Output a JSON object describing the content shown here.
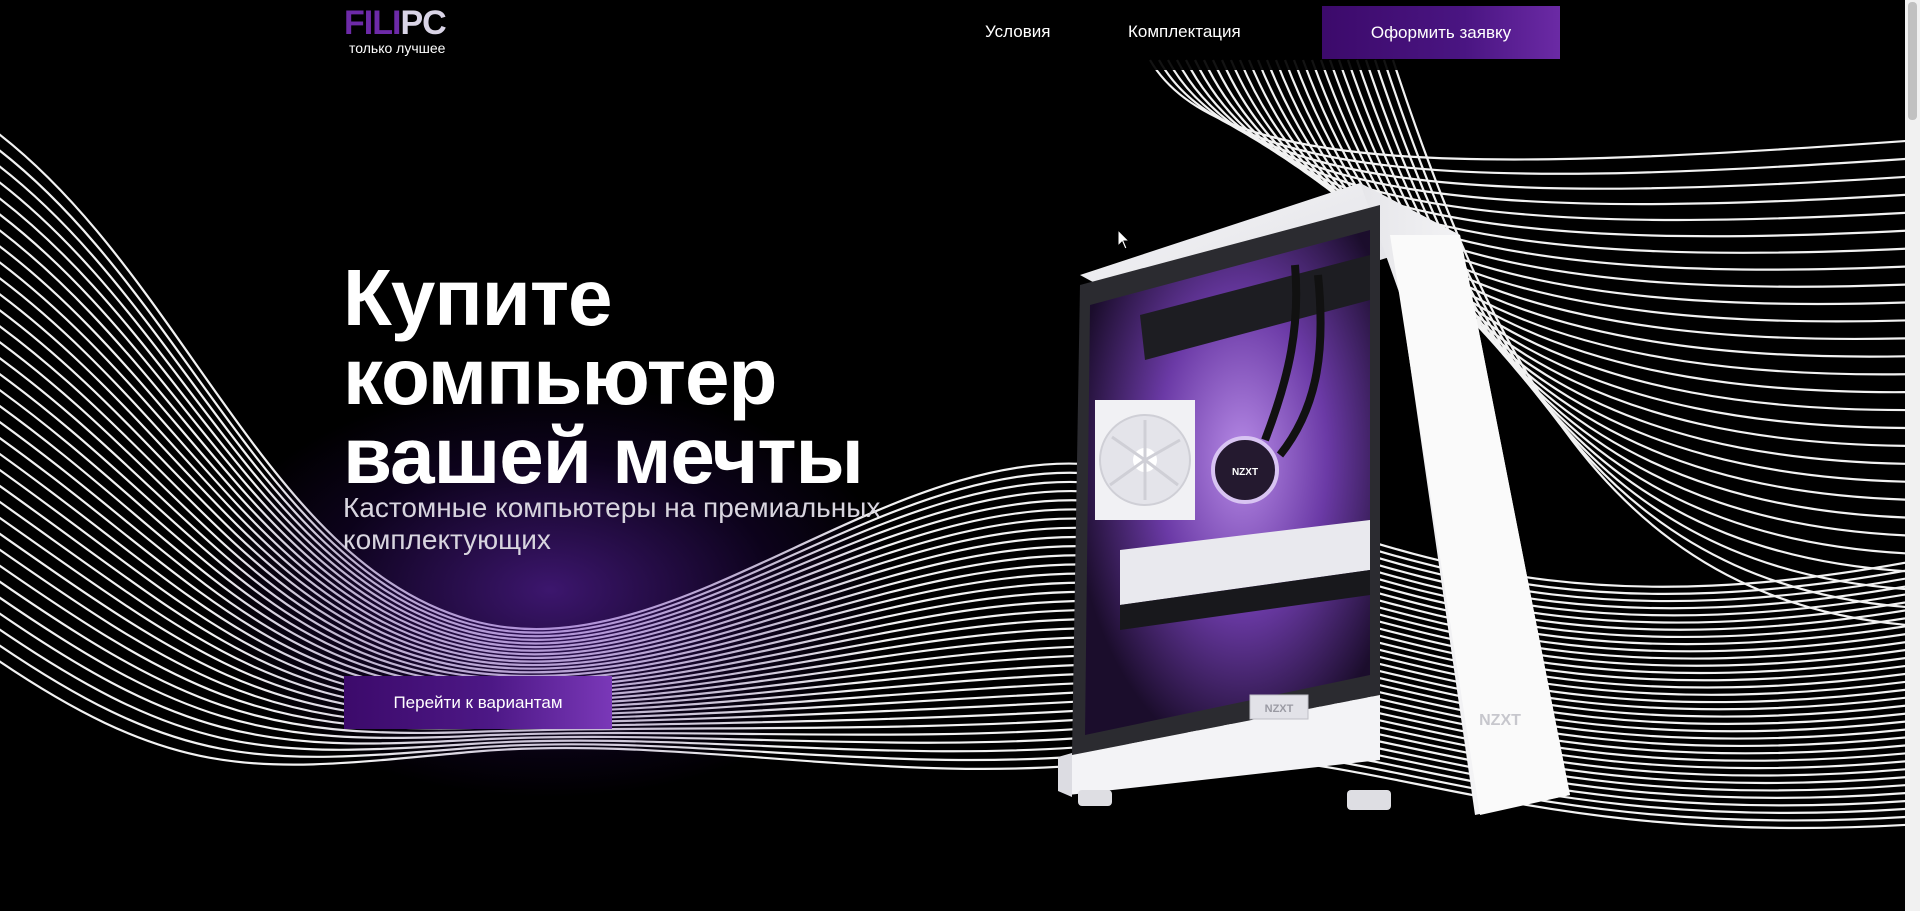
{
  "header": {
    "logo_part1": "FILI",
    "logo_part2": "PC",
    "tagline": "только лучшее",
    "nav": {
      "conditions": "Условия",
      "components": "Комплектация"
    },
    "cta": "Оформить заявку"
  },
  "hero": {
    "title_line1": "Купите",
    "title_line2": "компьютер",
    "title_line3": "вашей мечты",
    "subtitle": "Кастомные компьютеры на премиальных комплектующих",
    "cta": "Перейти к вариантам"
  },
  "product": {
    "brand_front": "NZXT",
    "brand_pump": "NZXT",
    "brand_gpu": "NZXT"
  },
  "colors": {
    "accent": "#4a1582",
    "accent_light": "#6d2aa8",
    "background": "#000000"
  }
}
